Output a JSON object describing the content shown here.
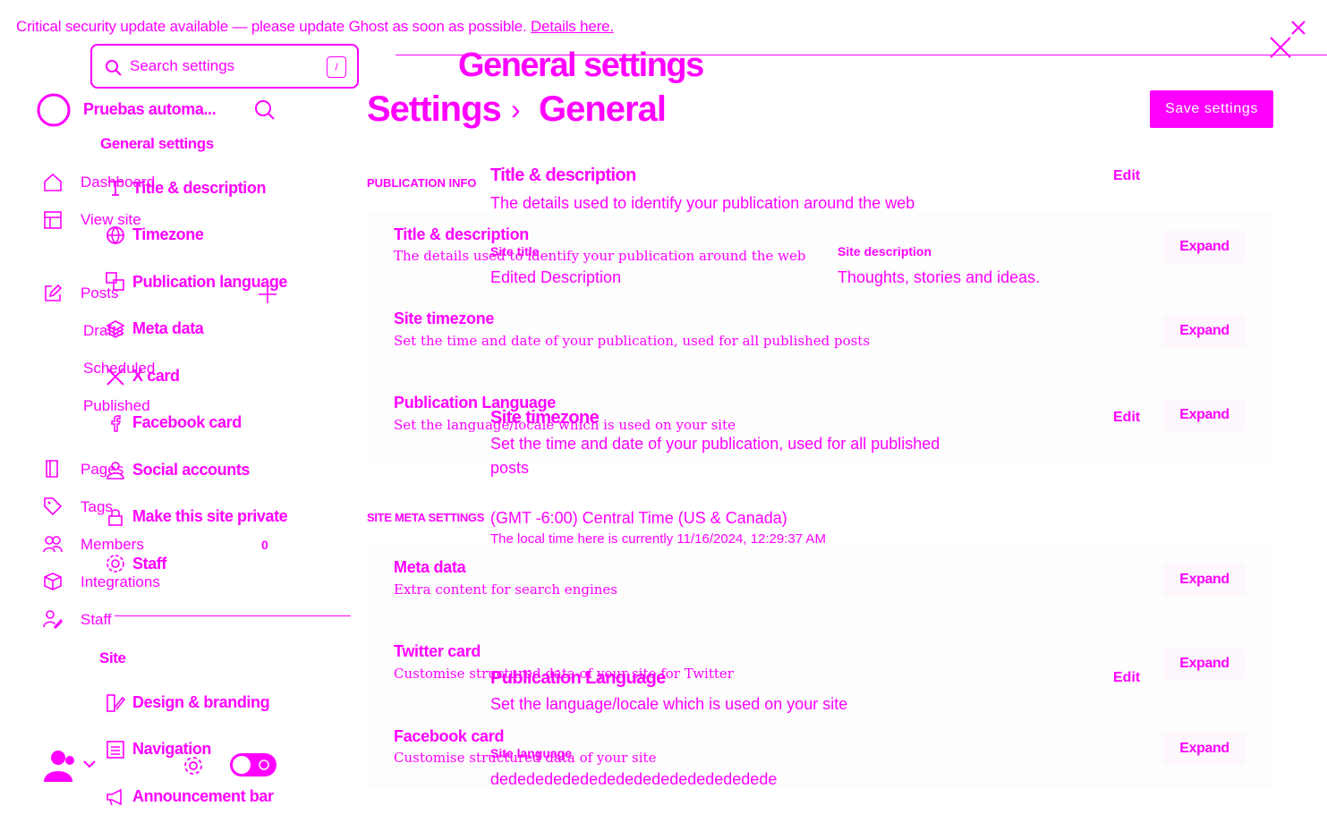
{
  "banner": {
    "text": "Critical security update available — please update Ghost as soon as possible.",
    "link": "Details here."
  },
  "search": {
    "placeholder": "Search settings",
    "shortcut": "/"
  },
  "modal_title": "General settings",
  "site": {
    "name": "Pruebas automa..."
  },
  "settings_nav": {
    "section_general": "General settings",
    "general_items": [
      {
        "label": "Title & description",
        "icon": "text-icon"
      },
      {
        "label": "Timezone",
        "icon": "globe-icon"
      },
      {
        "label": "Publication language",
        "icon": "translate-icon"
      },
      {
        "label": "Meta data",
        "icon": "layers-icon"
      },
      {
        "label": "X card",
        "icon": "x-logo-icon"
      },
      {
        "label": "Facebook card",
        "icon": "facebook-icon"
      },
      {
        "label": "Social accounts",
        "icon": "users-icon"
      },
      {
        "label": "Make this site private",
        "icon": "lock-icon"
      },
      {
        "label": "Staff",
        "icon": "gear-users-icon"
      }
    ],
    "section_site": "Site",
    "site_items": [
      {
        "label": "Design & branding",
        "icon": "brush-icon"
      },
      {
        "label": "Navigation",
        "icon": "list-icon"
      },
      {
        "label": "Announcement bar",
        "icon": "megaphone-icon"
      }
    ]
  },
  "main_nav": {
    "dashboard": "Dashboard",
    "view_site": "View site",
    "posts": "Posts",
    "drafts": "Drafts",
    "scheduled": "Scheduled",
    "published": "Published",
    "pages": "Pages",
    "tags": "Tags",
    "members": "Members",
    "members_count": "0",
    "integrations": "Integrations",
    "staff": "Staff"
  },
  "breadcrumb": {
    "root": "Settings",
    "separator": "›",
    "current": "General"
  },
  "save_button": "Save settings",
  "group_publication": "PUBLICATION INFO",
  "group_meta": "SITE META SETTINGS",
  "rows": [
    {
      "title": "Title & description",
      "desc": "The details used to identify your publication around the web",
      "action": "Expand"
    },
    {
      "title": "Site timezone",
      "desc": "Set the time and date of your publication, used for all published posts",
      "action": "Expand"
    },
    {
      "title": "Publication Language",
      "desc": "Set the language/locale which is used on your site",
      "action": "Expand"
    },
    {
      "title": "Meta data",
      "desc": "Extra content for search engines",
      "action": "Expand"
    },
    {
      "title": "Twitter card",
      "desc": "Customise structured data of your site for Twitter",
      "action": "Expand"
    },
    {
      "title": "Facebook card",
      "desc": "Customise structured data of your site",
      "action": "Expand"
    }
  ],
  "overlay": {
    "title_desc": {
      "heading": "Title & description",
      "desc": "The details used to identify your publication around the web",
      "edit": "Edit",
      "site_title_label": "Site title",
      "site_title_value": "Edited Description",
      "site_desc_label": "Site description",
      "site_desc_value": "Thoughts, stories and ideas."
    },
    "timezone": {
      "heading": "Site timezone",
      "desc_line1": "Set the time and date of your publication, used for all published",
      "desc_line2": "posts",
      "edit": "Edit",
      "value": "(GMT -6:00) Central Time (US & Canada)",
      "local_time": "The local time here is currently 11/16/2024, 12:29:37 AM"
    },
    "language": {
      "heading": "Publication Language",
      "desc": "Set the language/locale which is used on your site",
      "edit": "Edit",
      "label": "Site language",
      "value": "dededededededededededededededede"
    }
  },
  "colors": {
    "accent": "#ff00ff",
    "background": "#ffffff"
  }
}
